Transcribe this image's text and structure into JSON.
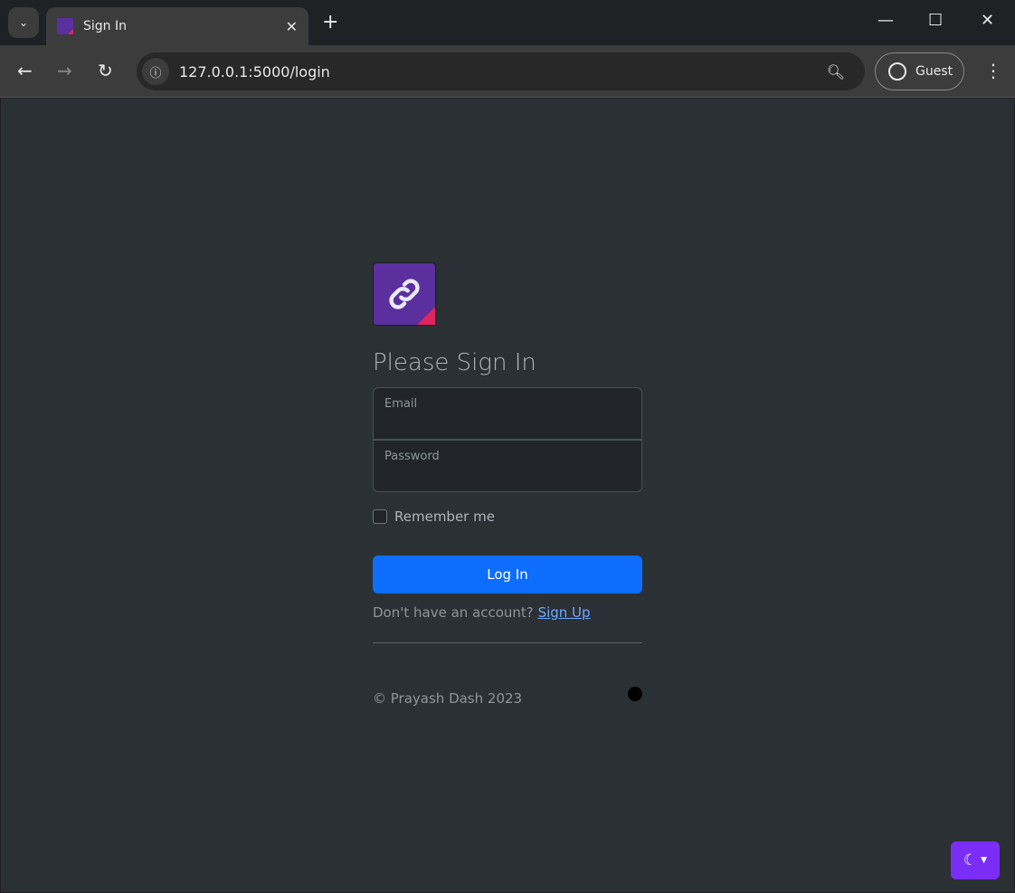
{
  "browser": {
    "tab_title": "Sign In",
    "url": "127.0.0.1:5000/login",
    "profile_label": "Guest"
  },
  "login": {
    "heading": "Please Sign In",
    "email_label": "Email",
    "password_label": "Password",
    "remember_label": "Remember me",
    "remember_checked": false,
    "submit_label": "Log In",
    "signup_prompt": "Don't have an account?",
    "signup_link": "Sign Up"
  },
  "footer": {
    "copyright": "© Prayash Dash 2023"
  },
  "colors": {
    "accent": "#0d6efd",
    "logo": "#5b2f9e",
    "logo_corner": "#e0245e",
    "theme_button": "#7a2ef5"
  }
}
